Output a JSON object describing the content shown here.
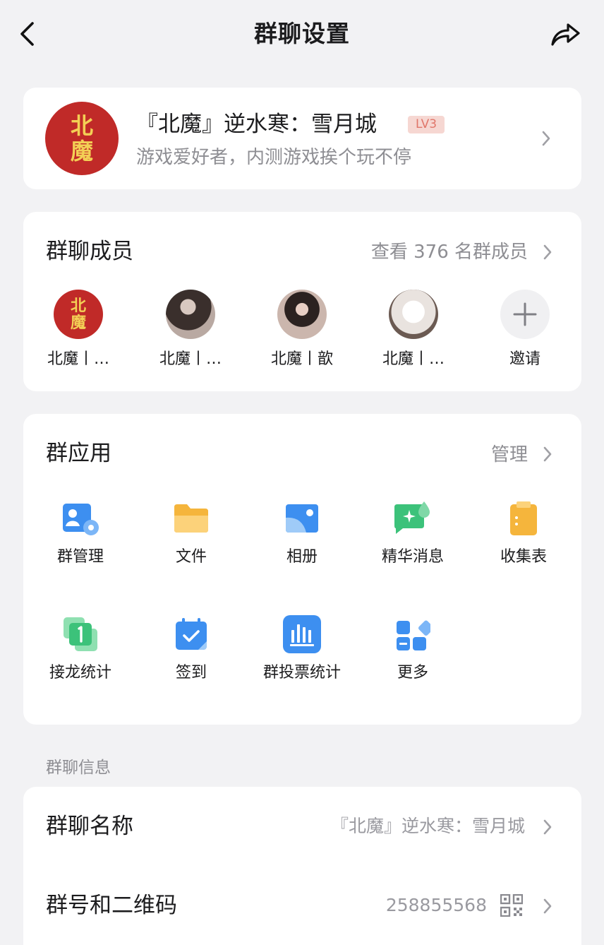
{
  "header": {
    "title": "群聊设置",
    "back_icon": "chevron-left-icon",
    "share_icon": "share-arrow-icon"
  },
  "group": {
    "avatar_text": "北魔",
    "name": "『北魔』逆水寒：雪月城",
    "level": "LV3",
    "description": "游戏爱好者，内测游戏挨个玩不停"
  },
  "members": {
    "title": "群聊成员",
    "view_all": "查看 376 名群成员",
    "list": [
      {
        "name": "北魔丨…"
      },
      {
        "name": "北魔丨…"
      },
      {
        "name": "北魔丨歆"
      },
      {
        "name": "北魔丨…"
      }
    ],
    "invite": "邀请"
  },
  "apps": {
    "title": "群应用",
    "manage": "管理",
    "items": [
      {
        "label": "群管理",
        "icon": "group-manage-icon",
        "color": "#3d8ff0"
      },
      {
        "label": "文件",
        "icon": "folder-icon",
        "color": "#f5b53c"
      },
      {
        "label": "相册",
        "icon": "album-icon",
        "color": "#3d8ff0"
      },
      {
        "label": "精华消息",
        "icon": "essence-message-icon",
        "color": "#3cc27a"
      },
      {
        "label": "收集表",
        "icon": "clipboard-icon",
        "color": "#f5b53c"
      },
      {
        "label": "接龙统计",
        "icon": "relay-icon",
        "color": "#3cc27a"
      },
      {
        "label": "签到",
        "icon": "checkin-calendar-icon",
        "color": "#3d8ff0"
      },
      {
        "label": "群投票统计",
        "icon": "vote-chart-icon",
        "color": "#3d8ff0"
      },
      {
        "label": "更多",
        "icon": "more-grid-icon",
        "color": "#3d8ff0"
      }
    ]
  },
  "info": {
    "heading": "群聊信息",
    "rows": [
      {
        "label": "群聊名称",
        "value": "『北魔』逆水寒：雪月城"
      },
      {
        "label": "群号和二维码",
        "value": "258855568",
        "icon": "qrcode-icon"
      }
    ]
  }
}
